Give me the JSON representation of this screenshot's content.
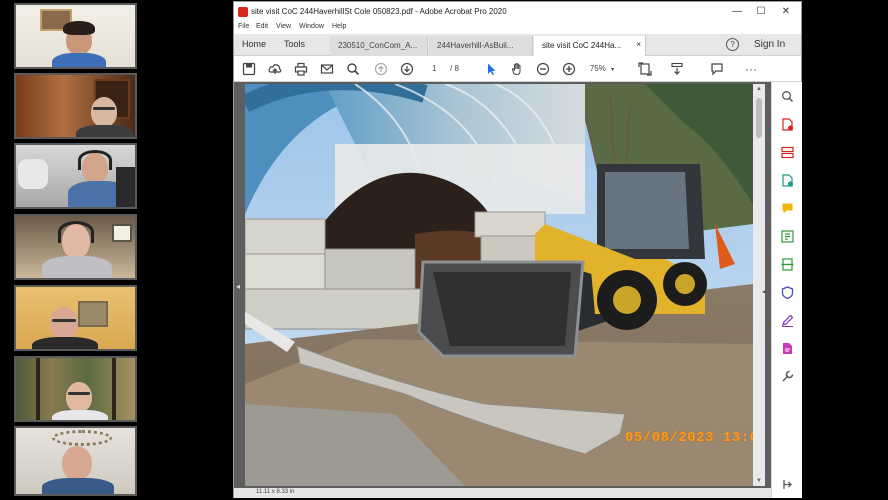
{
  "window": {
    "title": "site visit CoC 244HaverhillSt Cole 050823.pdf - Adobe Acrobat Pro 2020",
    "controls": {
      "minimize": "—",
      "maximize": "☐",
      "close": "✕"
    }
  },
  "menu": {
    "file": "File",
    "edit": "Edit",
    "view": "View",
    "window": "Window",
    "help": "Help"
  },
  "tabs": {
    "home": "Home",
    "tools": "Tools",
    "documents": [
      {
        "label": "230510_ConCom_A...",
        "active": false
      },
      {
        "label": "244Haverhill-AsBuil...",
        "active": false
      },
      {
        "label": "site visit CoC 244Ha...",
        "active": true
      }
    ],
    "close_glyph": "×",
    "help_glyph": "?",
    "sign_in": "Sign In"
  },
  "toolbar": {
    "page_current": "1",
    "page_total": "/ 8",
    "zoom": "75%",
    "more": "···"
  },
  "photo": {
    "timestamp": "05/08/2023 13:0"
  },
  "status": {
    "page_size": "11.11 x 8.33 in"
  },
  "colors": {
    "pdf_red": "#d5261f",
    "stamp_orange": "#ff9a1c",
    "loader_yellow": "#e2b22b"
  }
}
